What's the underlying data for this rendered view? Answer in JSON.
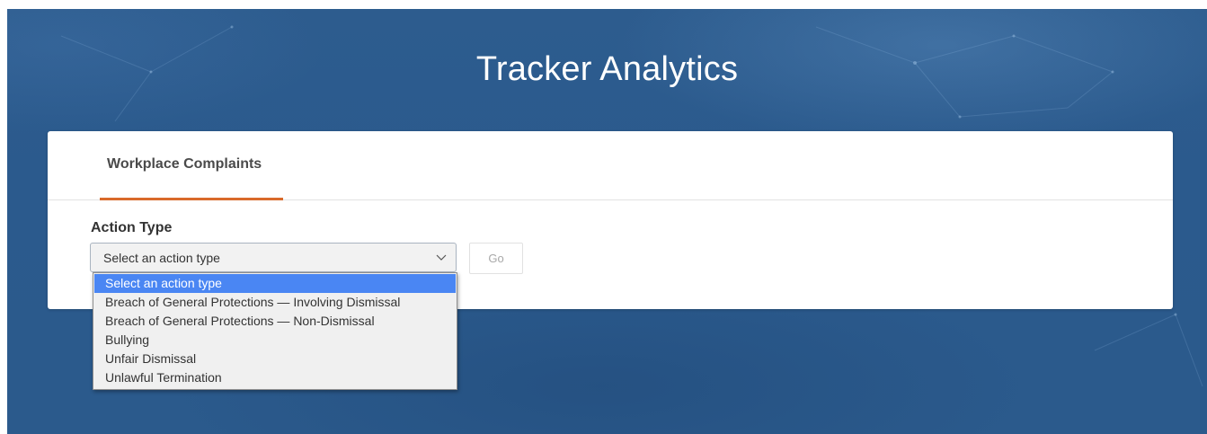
{
  "header": {
    "title": "Tracker Analytics"
  },
  "tabs": [
    {
      "label": "Workplace Complaints",
      "active": true
    }
  ],
  "form": {
    "field_label": "Action Type",
    "select_value": "Select an action type",
    "go_label": "Go",
    "go_enabled": false
  },
  "dropdown": {
    "options": [
      "Select an action type",
      "Breach of General Protections — Involving Dismissal",
      "Breach of General Protections — Non-Dismissal",
      "Bullying",
      "Unfair Dismissal",
      "Unlawful Termination"
    ],
    "selected_index": 0
  },
  "colors": {
    "background": "#2b5a8d",
    "tab_underline": "#d96a2b",
    "selected_option": "#4a86f3"
  },
  "icons": {
    "select_chevron": "chevron-down-icon"
  }
}
